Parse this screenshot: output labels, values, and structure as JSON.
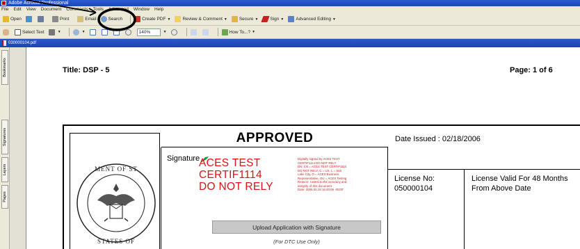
{
  "window": {
    "title": "Adobe Acrobat Professional"
  },
  "menu": [
    "File",
    "Edit",
    "View",
    "Document",
    "Comments",
    "Tools",
    "Advanced",
    "Window",
    "Help"
  ],
  "toolbar1": {
    "open": "Open",
    "print": "Print",
    "email": "Email",
    "search": "Search",
    "create_pdf": "Create PDF",
    "review_comment": "Review & Comment",
    "secure": "Secure",
    "sign": "Sign",
    "advanced_editing": "Advanced Editing"
  },
  "toolbar2": {
    "select_text": "Select Text",
    "zoom_value": "140%",
    "how_to": "How To...?"
  },
  "document": {
    "tab_name": "030000104.pdf",
    "title": "Title: DSP - 5",
    "page": "Page: 1 of 6",
    "approved": "APPROVED",
    "signature_label": "Signature",
    "signature_stamp": [
      "ACES TEST",
      "CERTIF1114",
      "DO NOT RELY"
    ],
    "signature_detail": "Digitally signed by ACES TEST\nCERTIF1114 DO NOT RELY\nDN: CN = ACES TEST CERTIF1114\nDO NOT RELY, C = US, L = Salt\nLake City, O = ACES Business\nRepresentative, OU = ACES Testing\nReason: I attest to the accuracy and\nintegrity of this document\nDate: 2006.02.18 16:40:09 -05'00'",
    "upload_button": "Upload Application with Signature",
    "dtc_note": "(For DTC Use Only)",
    "date_issued": "Date Issued : 02/18/2006",
    "license_no_label": "License No:",
    "license_no_value": "050000104",
    "license_valid": "License Valid For 48 Months From Above Date"
  },
  "nav_tabs": [
    "Bookmarks",
    "Signatures",
    "Layers",
    "Pages"
  ],
  "colors": {
    "titlebar": "#1d46b8",
    "chrome": "#ece9d8",
    "stamp_red": "#d11111",
    "annotation": "#000000"
  }
}
